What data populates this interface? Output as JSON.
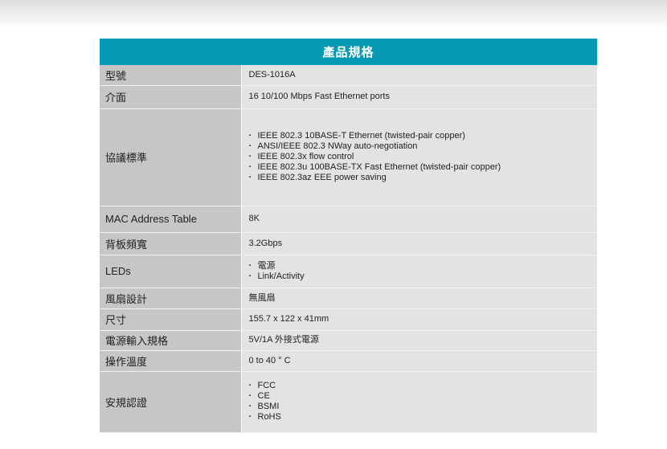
{
  "table": {
    "title": "產品規格",
    "rows": [
      {
        "label": "型號",
        "value": "DES-1016A"
      },
      {
        "label": "介面",
        "value": "16 10/100 Mbps Fast Ethernet ports"
      },
      {
        "label": "協議標準",
        "items": [
          "IEEE 802.3 10BASE-T Ethernet (twisted-pair copper)",
          "ANSI/IEEE 802.3 NWay auto-negotiation",
          "IEEE 802.3x flow control",
          "IEEE 802.3u 100BASE-TX Fast Ethernet (twisted-pair copper)",
          "IEEE 802.3az EEE power saving"
        ]
      },
      {
        "label": "MAC Address Table",
        "value": "8K"
      },
      {
        "label": "背板頻寬",
        "value": "3.2Gbps"
      },
      {
        "label": "LEDs",
        "items": [
          "電源",
          "Link/Activity"
        ]
      },
      {
        "label": "風扇設計",
        "value": "無風扇"
      },
      {
        "label": "尺寸",
        "value": "155.7 x 122 x 41mm"
      },
      {
        "label": "電源輸入規格",
        "value": "5V/1A 外接式電源"
      },
      {
        "label": "操作溫度",
        "value": "0 to 40 ° C"
      },
      {
        "label": "安規認證",
        "items": [
          "FCC",
          "CE",
          "BSMI",
          "RoHS"
        ]
      }
    ]
  },
  "colors": {
    "header_bg": "#0899b5",
    "label_bg": "#c6c6c6",
    "value_bg": "#e3e3e3"
  }
}
